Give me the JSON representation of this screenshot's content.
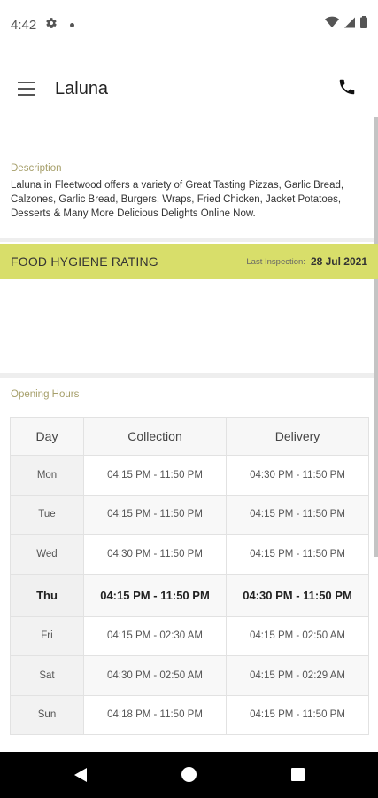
{
  "status_bar": {
    "time": "4:42"
  },
  "app_bar": {
    "title": "Laluna"
  },
  "description": {
    "label": "Description",
    "text": "Laluna in Fleetwood offers a variety of Great Tasting Pizzas, Garlic Bread, Calzones, Garlic Bread, Burgers, Wraps, Fried Chicken, Jacket Potatoes, Desserts & Many More Delicious Delights Online Now."
  },
  "hygiene": {
    "title": "FOOD HYGIENE RATING",
    "last_inspection_label": "Last Inspection:",
    "last_inspection_date": "28 Jul 2021"
  },
  "opening_hours": {
    "label": "Opening Hours",
    "headers": [
      "Day",
      "Collection",
      "Delivery"
    ],
    "rows": [
      {
        "day": "Mon",
        "collection": "04:15 PM - 11:50 PM",
        "delivery": "04:30 PM - 11:50 PM"
      },
      {
        "day": "Tue",
        "collection": "04:15 PM - 11:50 PM",
        "delivery": "04:15 PM - 11:50 PM"
      },
      {
        "day": "Wed",
        "collection": "04:30 PM - 11:50 PM",
        "delivery": "04:15 PM - 11:50 PM"
      },
      {
        "day": "Thu",
        "collection": "04:15 PM - 11:50 PM",
        "delivery": "04:30 PM - 11:50 PM"
      },
      {
        "day": "Fri",
        "collection": "04:15 PM - 02:30 AM",
        "delivery": "04:15 PM - 02:50 AM"
      },
      {
        "day": "Sat",
        "collection": "04:30 PM - 02:50 AM",
        "delivery": "04:15 PM - 02:29 AM"
      },
      {
        "day": "Sun",
        "collection": "04:18 PM - 11:50 PM",
        "delivery": "04:15 PM - 11:50 PM"
      }
    ]
  },
  "colors": {
    "hygiene_bar": "#d8de6a",
    "section_label": "#a69f6a"
  },
  "icons": {
    "menu": "hamburger-menu-icon",
    "phone": "phone-icon",
    "settings": "gear-icon",
    "wifi": "wifi-icon",
    "signal": "signal-icon",
    "battery": "battery-icon"
  }
}
